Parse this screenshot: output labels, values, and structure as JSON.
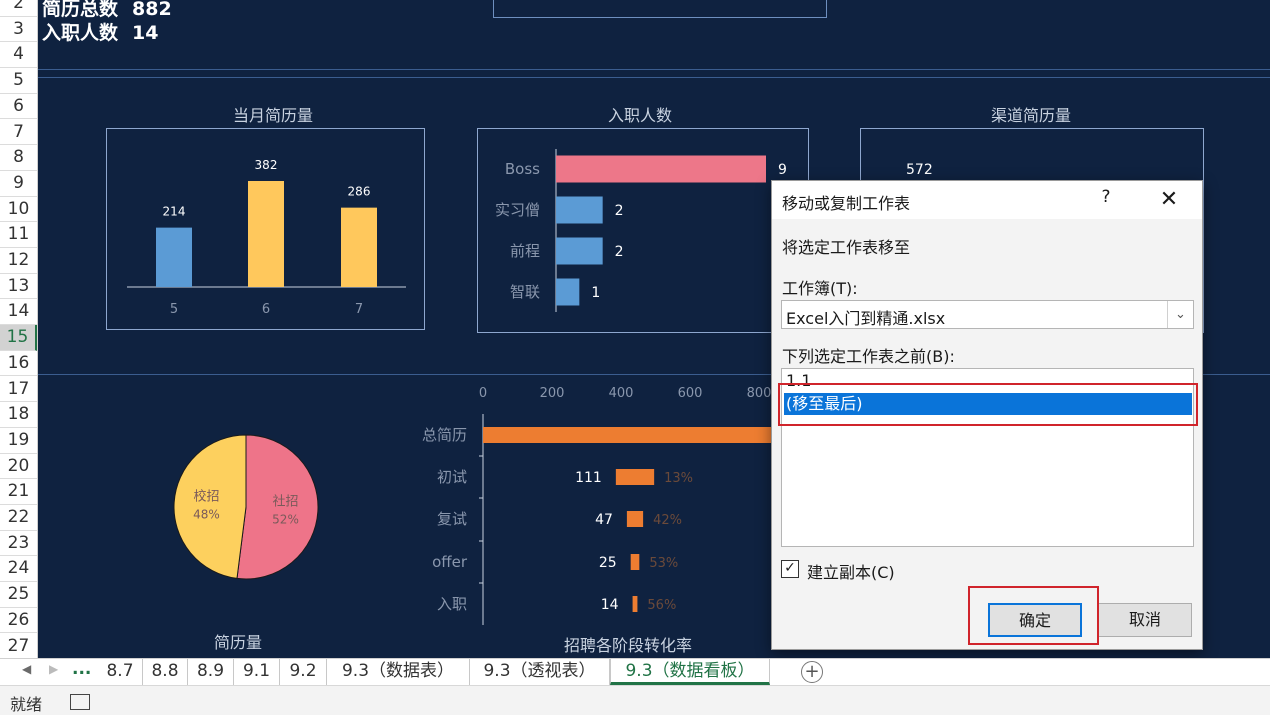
{
  "row_headers": [
    "2",
    "3",
    "4",
    "5",
    "6",
    "7",
    "8",
    "9",
    "10",
    "11",
    "12",
    "13",
    "14",
    "15",
    "16",
    "17",
    "18",
    "19",
    "20",
    "21",
    "22",
    "23",
    "24",
    "25",
    "26",
    "27"
  ],
  "active_row": "15",
  "kpis": {
    "resume_total_label": "简历总数",
    "resume_total_value": "882",
    "hires_label": "入职人数",
    "hires_value": "14"
  },
  "charts": {
    "monthly": {
      "title": "当月简历量",
      "categories": [
        "5",
        "6",
        "7"
      ],
      "values": [
        214,
        382,
        286
      ],
      "colors": [
        "#5b9bd5",
        "#ffc85c",
        "#ffc85c"
      ]
    },
    "hires": {
      "title": "入职人数",
      "categories": [
        "Boss",
        "实习僧",
        "前程",
        "智联"
      ],
      "values": [
        9,
        2,
        2,
        1
      ],
      "colors": [
        "#ed7789",
        "#5b9bd5",
        "#5b9bd5",
        "#5b9bd5"
      ]
    },
    "channel": {
      "title": "渠道简历量",
      "value_label": "572"
    },
    "pie": {
      "title": "简历量",
      "slices": [
        {
          "name": "社招",
          "pct": 52,
          "label": "52%",
          "color": "#ee7489"
        },
        {
          "name": "校招",
          "pct": 48,
          "label": "48%",
          "color": "#fdd05e"
        }
      ]
    },
    "funnel": {
      "title": "招聘各阶段转化率",
      "axis_ticks": [
        "0",
        "200",
        "400",
        "600",
        "800"
      ],
      "stages": [
        "总简历",
        "初试",
        "复试",
        "offer",
        "入职"
      ],
      "values": [
        882,
        111,
        47,
        25,
        14
      ],
      "value_labels": [
        "",
        "111",
        "47",
        "25",
        "14"
      ],
      "rates": [
        "",
        "13%",
        "42%",
        "53%",
        "56%"
      ],
      "color": "#ed7d31"
    }
  },
  "chart_data": [
    {
      "type": "bar",
      "title": "当月简历量",
      "categories": [
        "5",
        "6",
        "7"
      ],
      "values": [
        214,
        382,
        286
      ]
    },
    {
      "type": "bar",
      "title": "入职人数",
      "categories": [
        "Boss",
        "实习僧",
        "前程",
        "智联"
      ],
      "values": [
        9,
        2,
        2,
        1
      ]
    },
    {
      "type": "pie",
      "title": "简历量",
      "categories": [
        "社招",
        "校招"
      ],
      "values": [
        52,
        48
      ]
    },
    {
      "type": "bar",
      "title": "招聘各阶段转化率",
      "categories": [
        "总简历",
        "初试",
        "复试",
        "offer",
        "入职"
      ],
      "values": [
        882,
        111,
        47,
        25,
        14
      ],
      "rates": [
        "",
        "13%",
        "42%",
        "53%",
        "56%"
      ]
    }
  ],
  "dialog": {
    "title": "移动或复制工作表",
    "help": "?",
    "close": "✕",
    "move_label": "将选定工作表移至",
    "workbook_label": "工作簿(T):",
    "workbook_value": "Excel入门到精通.xlsx",
    "before_label": "下列选定工作表之前(B):",
    "sheet_items": [
      "1.1",
      "(移至最后)"
    ],
    "selected_index": 1,
    "copy_checked": true,
    "copy_label": "建立副本(C)",
    "ok": "确定",
    "cancel": "取消"
  },
  "tabs": {
    "more": "...",
    "items": [
      "8.7",
      "8.8",
      "8.9",
      "9.1",
      "9.2",
      "9.3（数据表）",
      "9.3（透视表）",
      "9.3（数据看板）"
    ],
    "active": "9.3（数据看板）"
  },
  "status": {
    "text": "就绪"
  }
}
